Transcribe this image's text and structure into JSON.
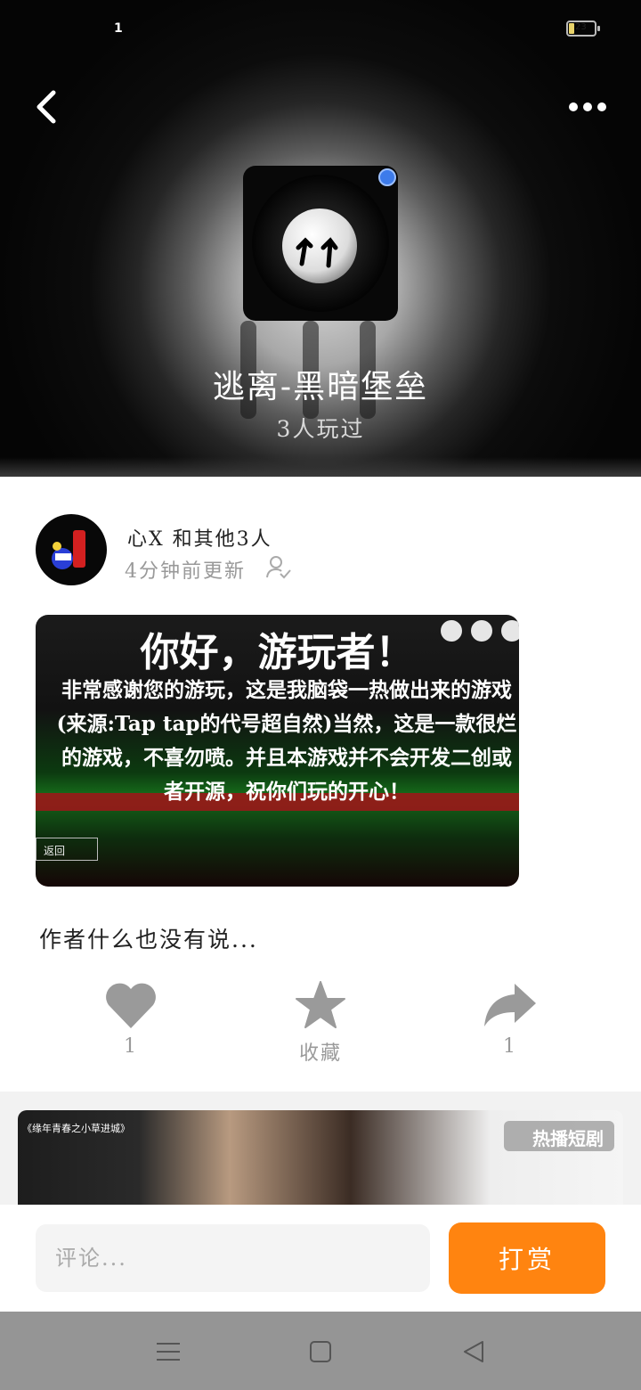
{
  "status": {
    "time": "1",
    "battery": "23"
  },
  "header": {
    "game_title": "逃离-黑暗堡垒",
    "play_count": "3人玩过"
  },
  "post": {
    "users": "心X 和其他3人",
    "updated": "4分钟前更新",
    "screenshot": {
      "headline": "你好，游玩者！",
      "body": "非常感谢您的游玩，这是我脑袋一热做出来的游戏(来源:Tap tap的代号超自然)当然，这是一款很烂的游戏，不喜勿喷。并且本游戏并不会开发二创或者开源，祝你们玩的开心！",
      "back_label": "返回"
    },
    "description": "作者什么也没有说...",
    "actions": {
      "like_count": "1",
      "favorite_label": "收藏",
      "share_count": "1"
    }
  },
  "recommend": {
    "caption": "《缘年青春之小草进城》",
    "badge": "热播短剧"
  },
  "bottom": {
    "comment_placeholder": "评论...",
    "tip_label": "打赏"
  },
  "colors": {
    "accent": "#ff8410",
    "icon_gray": "#9a9a9a"
  }
}
